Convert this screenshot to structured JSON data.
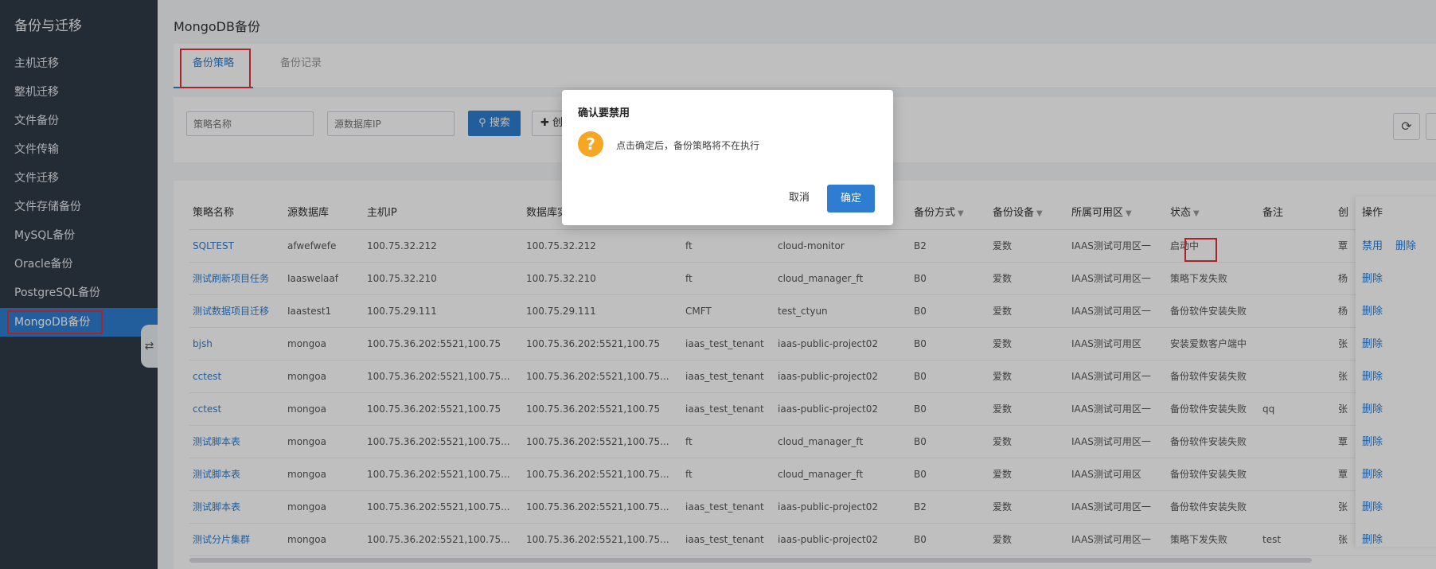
{
  "sidebar": {
    "title": "备份与迁移",
    "items": [
      {
        "label": "主机迁移"
      },
      {
        "label": "整机迁移"
      },
      {
        "label": "文件备份"
      },
      {
        "label": "文件传输"
      },
      {
        "label": "文件迁移"
      },
      {
        "label": "文件存储备份"
      },
      {
        "label": "MySQL备份"
      },
      {
        "label": "Oracle备份"
      },
      {
        "label": "PostgreSQL备份"
      },
      {
        "label": "MongoDB备份"
      }
    ],
    "collapse_icon": "⇄"
  },
  "page": {
    "title": "MongoDB备份"
  },
  "tabs": [
    {
      "label": "备份策略"
    },
    {
      "label": "备份记录"
    }
  ],
  "filters": {
    "strategy_placeholder": "策略名称",
    "source_ip_placeholder": "源数据库IP",
    "search_label": "搜索",
    "create_label": "创"
  },
  "table": {
    "columns": [
      "策略名称",
      "源数据库",
      "主机IP",
      "数据库实",
      "",
      "",
      "备份方式",
      "备份设备",
      "所属可用区",
      "状态",
      "备注",
      "创"
    ],
    "ops_header": "操作",
    "rows": [
      {
        "name": "SQLTEST",
        "db": "afwefwefe",
        "host": "100.75.32.212",
        "inst": "100.75.32.212",
        "c5": "ft",
        "c6": "cloud-monitor",
        "mode": "B2",
        "dev": "爱数",
        "zone": "IAAS测试可用区一",
        "status": "启动中",
        "note": "",
        "creator": "覃",
        "ops": [
          "禁用",
          "删除"
        ]
      },
      {
        "name": "测试刷新项目任务",
        "db": "Iaaswelaaf",
        "host": "100.75.32.210",
        "inst": "100.75.32.210",
        "c5": "ft",
        "c6": "cloud_manager_ft",
        "mode": "B0",
        "dev": "爱数",
        "zone": "IAAS测试可用区一",
        "status": "策略下发失败",
        "note": "",
        "creator": "杨",
        "ops": [
          "删除"
        ]
      },
      {
        "name": "测试数据项目迁移",
        "db": "Iaastest1",
        "host": "100.75.29.111",
        "inst": "100.75.29.111",
        "c5": "CMFT",
        "c6": "test_ctyun",
        "mode": "B0",
        "dev": "爱数",
        "zone": "IAAS测试可用区一",
        "status": "备份软件安装失败",
        "note": "",
        "creator": "杨",
        "ops": [
          "删除"
        ]
      },
      {
        "name": "bjsh",
        "db": "mongoa",
        "host": "100.75.36.202:5521,100.75",
        "inst": "100.75.36.202:5521,100.75",
        "c5": "iaas_test_tenant",
        "c6": "iaas-public-project02",
        "mode": "B0",
        "dev": "爱数",
        "zone": "IAAS测试可用区",
        "status": "安装爱数客户端中",
        "note": "",
        "creator": "张",
        "ops": [
          "删除"
        ]
      },
      {
        "name": "cctest",
        "db": "mongoa",
        "host": "100.75.36.202:5521,100.75...",
        "inst": "100.75.36.202:5521,100.75...",
        "c5": "iaas_test_tenant",
        "c6": "iaas-public-project02",
        "mode": "B0",
        "dev": "爱数",
        "zone": "IAAS测试可用区一",
        "status": "备份软件安装失败",
        "note": "",
        "creator": "张",
        "ops": [
          "删除"
        ]
      },
      {
        "name": "cctest",
        "db": "mongoa",
        "host": "100.75.36.202:5521,100.75",
        "inst": "100.75.36.202:5521,100.75",
        "c5": "iaas_test_tenant",
        "c6": "iaas-public-project02",
        "mode": "B0",
        "dev": "爱数",
        "zone": "IAAS测试可用区一",
        "status": "备份软件安装失败",
        "note": "qq",
        "creator": "张",
        "ops": [
          "删除"
        ]
      },
      {
        "name": "测试脚本表",
        "db": "mongoa",
        "host": "100.75.36.202:5521,100.75...",
        "inst": "100.75.36.202:5521,100.75...",
        "c5": "ft",
        "c6": "cloud_manager_ft",
        "mode": "B0",
        "dev": "爱数",
        "zone": "IAAS测试可用区一",
        "status": "备份软件安装失败",
        "note": "",
        "creator": "覃",
        "ops": [
          "删除"
        ]
      },
      {
        "name": "测试脚本表",
        "db": "mongoa",
        "host": "100.75.36.202:5521,100.75...",
        "inst": "100.75.36.202:5521,100.75...",
        "c5": "ft",
        "c6": "cloud_manager_ft",
        "mode": "B0",
        "dev": "爱数",
        "zone": "IAAS测试可用区",
        "status": "备份软件安装失败",
        "note": "",
        "creator": "覃",
        "ops": [
          "删除"
        ]
      },
      {
        "name": "测试脚本表",
        "db": "mongoa",
        "host": "100.75.36.202:5521,100.75...",
        "inst": "100.75.36.202:5521,100.75...",
        "c5": "iaas_test_tenant",
        "c6": "iaas-public-project02",
        "mode": "B2",
        "dev": "爱数",
        "zone": "IAAS测试可用区一",
        "status": "备份软件安装失败",
        "note": "",
        "creator": "张",
        "ops": [
          "删除"
        ]
      },
      {
        "name": "测试分片集群",
        "db": "mongoa",
        "host": "100.75.36.202:5521,100.75...",
        "inst": "100.75.36.202:5521,100.75...",
        "c5": "iaas_test_tenant",
        "c6": "iaas-public-project02",
        "mode": "B0",
        "dev": "爱数",
        "zone": "IAAS测试可用区一",
        "status": "策略下发失败",
        "note": "test",
        "creator": "张",
        "ops": [
          "删除"
        ]
      }
    ]
  },
  "dialog": {
    "title": "确认要禁用",
    "message": "点击确定后，备份策略将不在执行",
    "icon": "?",
    "cancel_label": "取消",
    "ok_label": "确定"
  },
  "colors": {
    "accent": "#2e7dd1",
    "sidebar_bg": "#2f3a47",
    "highlight": "#e0303a",
    "warning": "#f5a623"
  }
}
